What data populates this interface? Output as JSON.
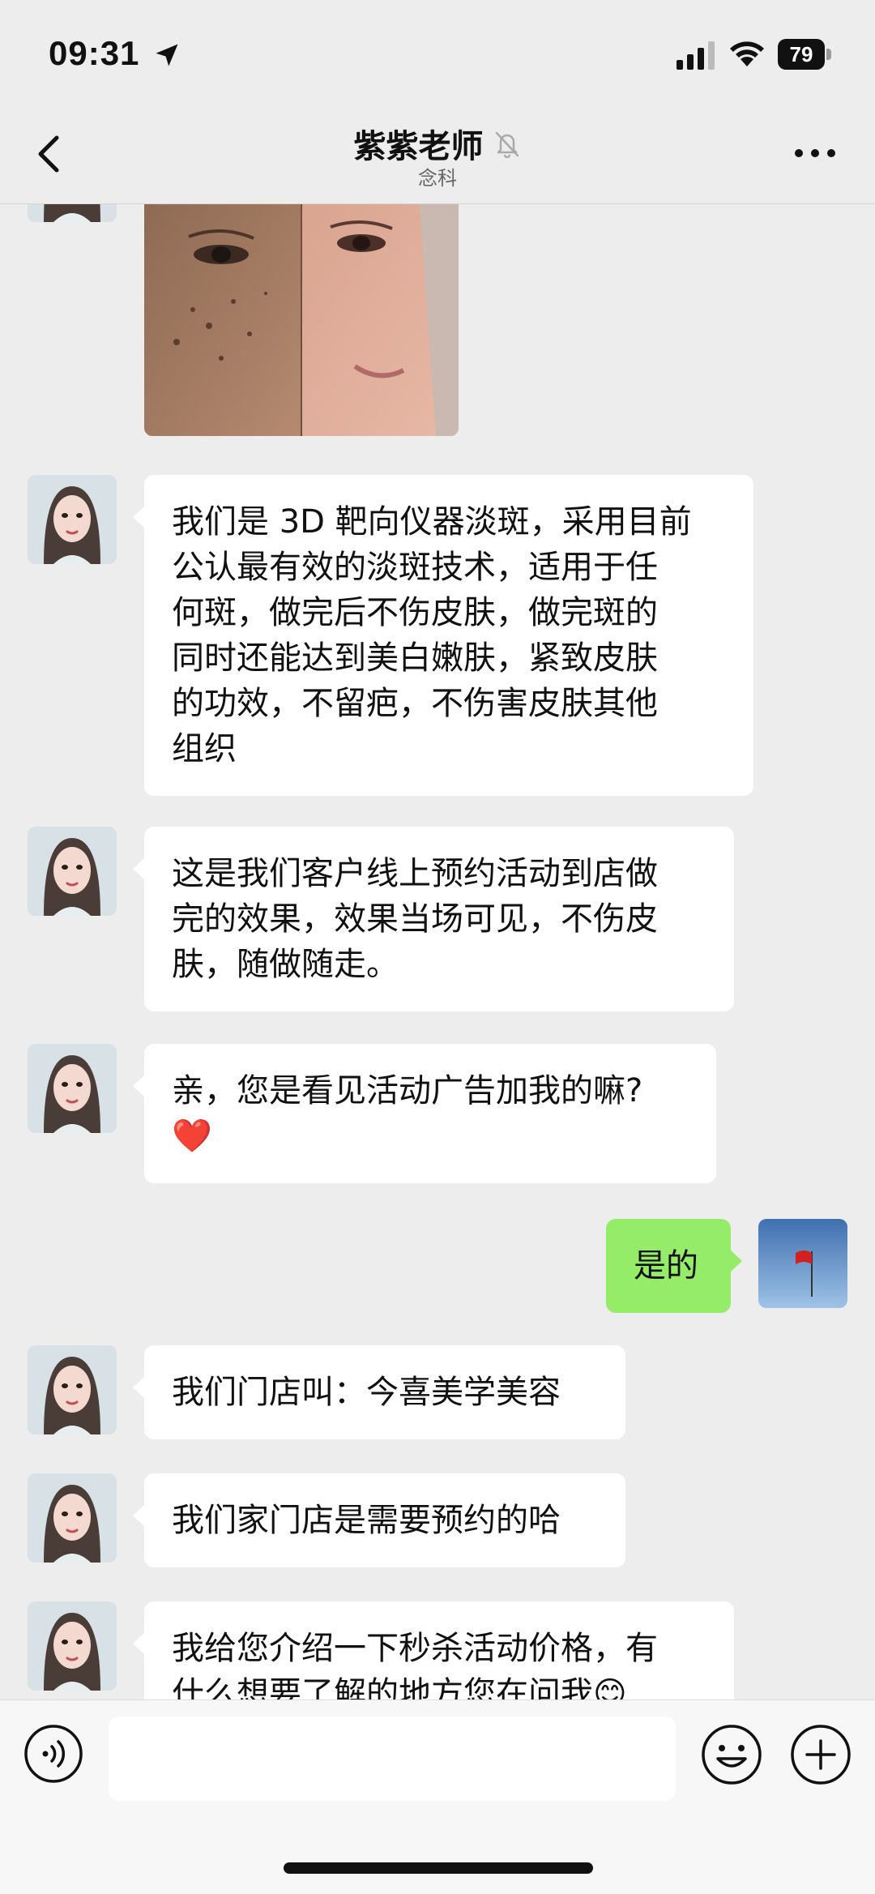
{
  "status_bar": {
    "time": "09:31",
    "battery": "79"
  },
  "header": {
    "title": "紫紫老师",
    "subtitle": "念科"
  },
  "messages": [
    {
      "side": "left",
      "type": "image"
    },
    {
      "side": "left",
      "type": "text",
      "text": "我们是 3D 靶向仪器淡斑，采用目前\n公认最有效的淡斑技术，适用于任\n何斑，做完后不伤皮肤，做完斑的\n同时还能达到美白嫩肤，紧致皮肤\n的功效，不留疤，不伤害皮肤其他\n组织"
    },
    {
      "side": "left",
      "type": "text",
      "text": "这是我们客户线上预约活动到店做\n完的效果，效果当场可见，不伤皮\n肤，随做随走。"
    },
    {
      "side": "left",
      "type": "text",
      "text": "亲，您是看见活动广告加我的嘛?\n❤️"
    },
    {
      "side": "right",
      "type": "text",
      "text": "是的"
    },
    {
      "side": "left",
      "type": "text",
      "text": "我们门店叫：今喜美学美容"
    },
    {
      "side": "left",
      "type": "text",
      "text": "我们家门店是需要预约的哈"
    },
    {
      "side": "left",
      "type": "text",
      "text": "我给您介绍一下秒杀活动价格，有\n什么想要了解的地方您在问我😊"
    }
  ],
  "input": {
    "value": "",
    "placeholder": ""
  },
  "icons": {
    "back": "chevron-left-icon",
    "mute": "bell-slash-icon",
    "more": "more-dots-icon",
    "voice": "voice-icon",
    "emoji": "emoji-icon",
    "plus": "plus-icon"
  },
  "colors": {
    "my_bubble": "#95ec69",
    "their_bubble": "#ffffff",
    "background": "#ededed"
  }
}
